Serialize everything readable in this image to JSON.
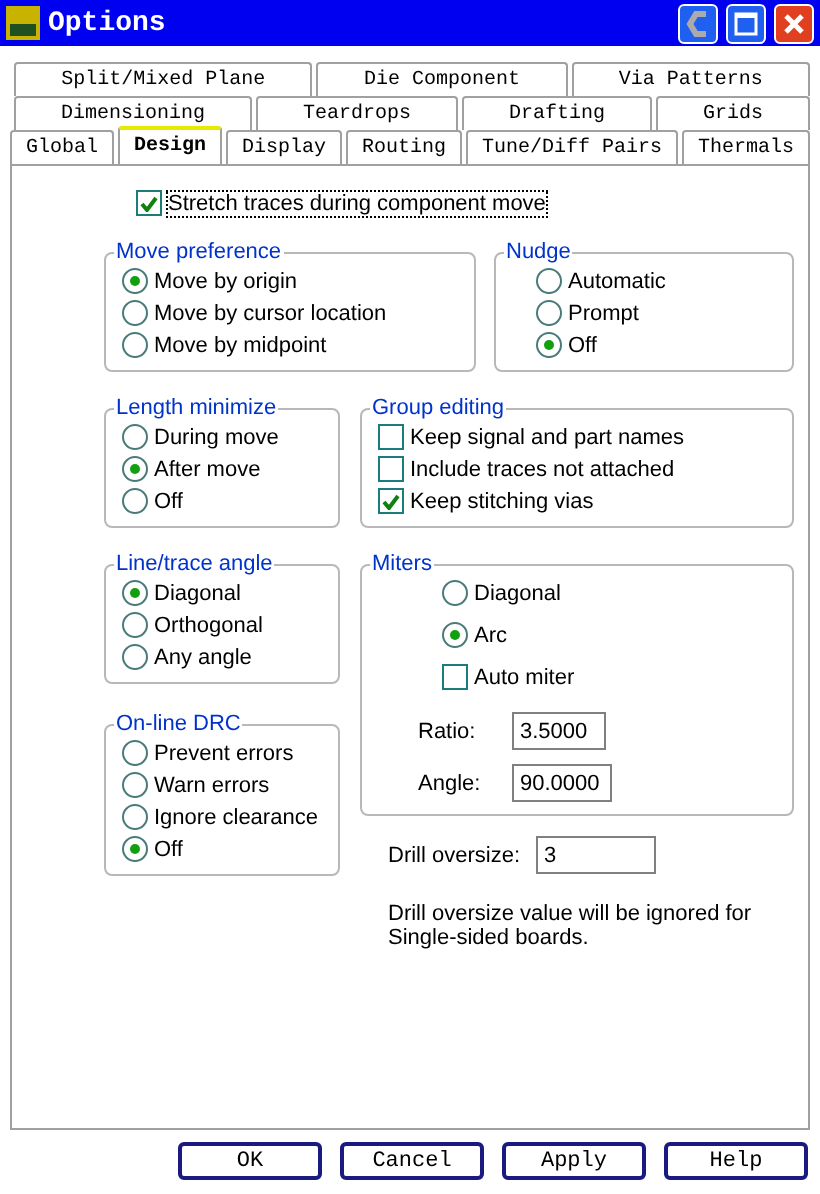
{
  "window": {
    "title": "Options"
  },
  "tab_rows": [
    [
      {
        "label": "Split/Mixed Plane",
        "selected": false
      },
      {
        "label": "Die Component",
        "selected": false
      },
      {
        "label": "Via Patterns",
        "selected": false
      }
    ],
    [
      {
        "label": "Dimensioning",
        "selected": false
      },
      {
        "label": "Teardrops",
        "selected": false
      },
      {
        "label": "Drafting",
        "selected": false
      },
      {
        "label": "Grids",
        "selected": false
      }
    ],
    [
      {
        "label": "Global",
        "selected": false
      },
      {
        "label": "Design",
        "selected": true
      },
      {
        "label": "Display",
        "selected": false
      },
      {
        "label": "Routing",
        "selected": false
      },
      {
        "label": "Tune/Diff Pairs",
        "selected": false
      },
      {
        "label": "Thermals",
        "selected": false
      }
    ]
  ],
  "stretch": {
    "label": "Stretch traces during component move",
    "checked": true
  },
  "groups": [
    {
      "label": "Move preference",
      "items": [
        {
          "kind": "radio",
          "label": "Move by origin",
          "selected": true
        },
        {
          "kind": "radio",
          "label": "Move by cursor location",
          "selected": false
        },
        {
          "kind": "radio",
          "label": "Move by midpoint",
          "selected": false
        }
      ]
    },
    {
      "label": "Nudge",
      "items": [
        {
          "kind": "radio",
          "label": "Automatic",
          "selected": false
        },
        {
          "kind": "radio",
          "label": "Prompt",
          "selected": false
        },
        {
          "kind": "radio",
          "label": "Off",
          "selected": true
        }
      ]
    },
    {
      "label": "Length minimize",
      "items": [
        {
          "kind": "radio",
          "label": "During move",
          "selected": false
        },
        {
          "kind": "radio",
          "label": "After move",
          "selected": true
        },
        {
          "kind": "radio",
          "label": "Off",
          "selected": false
        }
      ]
    },
    {
      "label": "Group editing",
      "items": [
        {
          "kind": "checkbox",
          "label": "Keep signal and part names",
          "checked": false
        },
        {
          "kind": "checkbox",
          "label": "Include traces not attached",
          "checked": false
        },
        {
          "kind": "checkbox",
          "label": "Keep stitching vias",
          "checked": true
        }
      ]
    },
    {
      "label": "Line/trace angle",
      "items": [
        {
          "kind": "radio",
          "label": "Diagonal",
          "selected": true
        },
        {
          "kind": "radio",
          "label": "Orthogonal",
          "selected": false
        },
        {
          "kind": "radio",
          "label": "Any angle",
          "selected": false
        }
      ]
    },
    {
      "label": "On-line DRC",
      "items": [
        {
          "kind": "radio",
          "label": "Prevent errors",
          "selected": false
        },
        {
          "kind": "radio",
          "label": "Warn errors",
          "selected": false
        },
        {
          "kind": "radio",
          "label": "Ignore clearance",
          "selected": false
        },
        {
          "kind": "radio",
          "label": "Off",
          "selected": true
        }
      ]
    },
    {
      "label": "Miters",
      "items": [
        {
          "kind": "radio",
          "label": "Diagonal",
          "selected": false
        },
        {
          "kind": "radio",
          "label": "Arc",
          "selected": true
        },
        {
          "kind": "checkbox",
          "label": "Auto miter",
          "checked": false
        },
        {
          "kind": "field",
          "label": "Ratio:",
          "value": "3.5000"
        },
        {
          "kind": "field",
          "label": "Angle:",
          "value": "90.0000"
        }
      ]
    }
  ],
  "drill_oversize": {
    "label": "Drill oversize:",
    "value": "3"
  },
  "note": "Drill oversize value will be ignored for Single-sided boards.",
  "buttons": [
    "OK",
    "Cancel",
    "Apply",
    "Help"
  ]
}
